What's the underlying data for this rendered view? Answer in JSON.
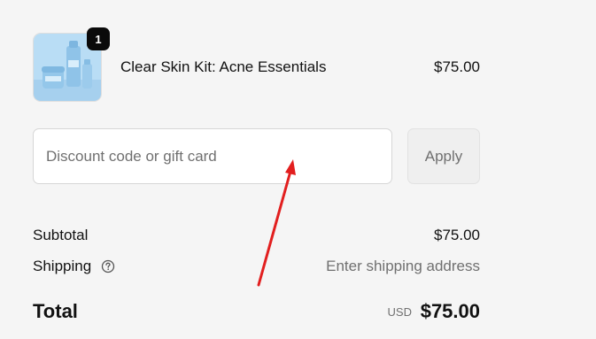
{
  "product": {
    "name": "Clear Skin Kit: Acne Essentials",
    "price": "$75.00",
    "quantity": "1",
    "image_icon": "skincare-bottles-image"
  },
  "discount": {
    "placeholder": "Discount code or gift card",
    "value": "",
    "apply_label": "Apply"
  },
  "summary": {
    "subtotal_label": "Subtotal",
    "subtotal_value": "$75.00",
    "shipping_label": "Shipping",
    "shipping_value": "Enter shipping address",
    "help_icon": "question-circle-icon",
    "total_label": "Total",
    "currency": "USD",
    "total_value": "$75.00"
  },
  "colors": {
    "background": "#f5f5f5",
    "badge": "#0a0a0a",
    "muted_text": "#707070",
    "annotation_arrow": "#e21f1f",
    "product_blue": "#a9d4f0"
  }
}
